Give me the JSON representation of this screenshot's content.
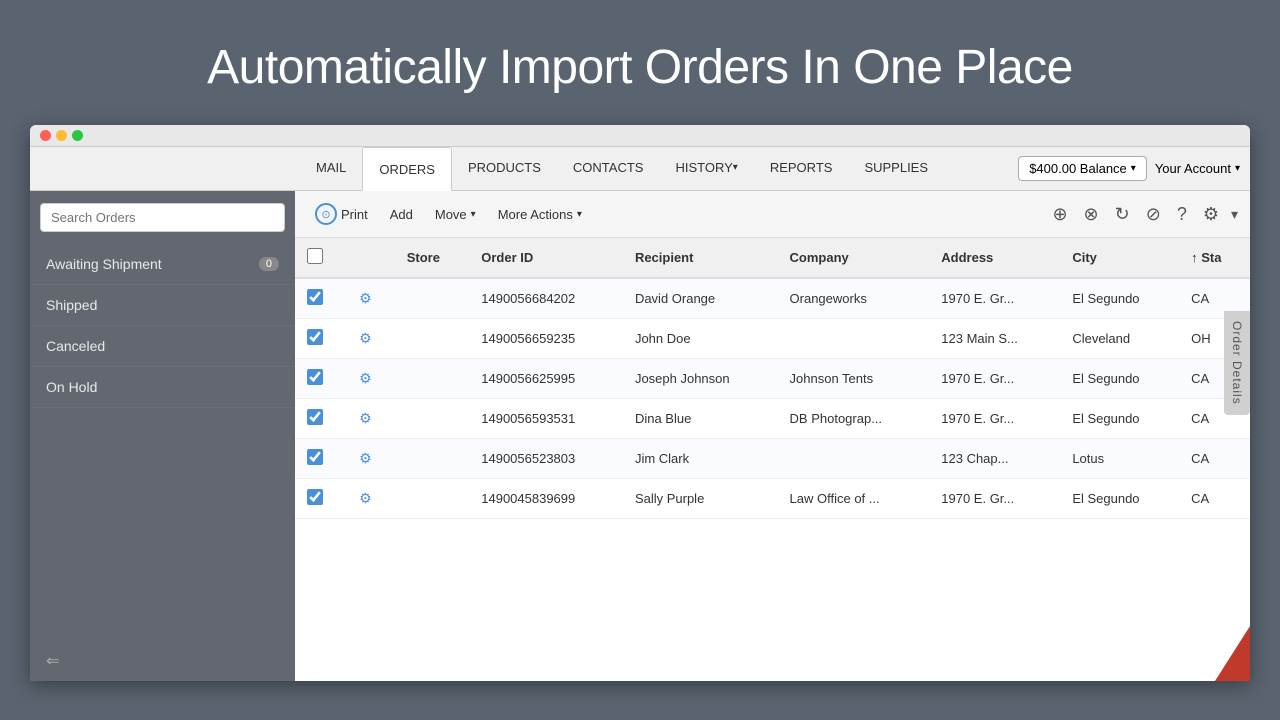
{
  "hero": {
    "title": "Automatically Import Orders In One Place"
  },
  "nav": {
    "items": [
      {
        "label": "MAIL",
        "id": "mail",
        "active": false,
        "hasArrow": false
      },
      {
        "label": "ORDERS",
        "id": "orders",
        "active": true,
        "hasArrow": false
      },
      {
        "label": "PRODUCTS",
        "id": "products",
        "active": false,
        "hasArrow": false
      },
      {
        "label": "CONTACTS",
        "id": "contacts",
        "active": false,
        "hasArrow": false
      },
      {
        "label": "HISTORY",
        "id": "history",
        "active": false,
        "hasArrow": true
      },
      {
        "label": "REPORTS",
        "id": "reports",
        "active": false,
        "hasArrow": false
      },
      {
        "label": "SUPPLIES",
        "id": "supplies",
        "active": false,
        "hasArrow": false
      }
    ],
    "balance": "$400.00 Balance",
    "account": "Your Account"
  },
  "sidebar": {
    "search_placeholder": "Search Orders",
    "items": [
      {
        "label": "Awaiting Shipment",
        "badge": "0",
        "active": false
      },
      {
        "label": "Shipped",
        "badge": null,
        "active": false
      },
      {
        "label": "Canceled",
        "badge": null,
        "active": false
      },
      {
        "label": "On Hold",
        "badge": null,
        "active": false
      }
    ]
  },
  "toolbar": {
    "print_label": "Print",
    "add_label": "Add",
    "move_label": "Move",
    "more_actions_label": "More Actions"
  },
  "table": {
    "columns": [
      {
        "label": "",
        "id": "checkbox"
      },
      {
        "label": "",
        "id": "gear"
      },
      {
        "label": "Store",
        "id": "store"
      },
      {
        "label": "Order ID",
        "id": "order_id"
      },
      {
        "label": "Recipient",
        "id": "recipient"
      },
      {
        "label": "Company",
        "id": "company"
      },
      {
        "label": "Address",
        "id": "address"
      },
      {
        "label": "City",
        "id": "city"
      },
      {
        "label": "↑ Sta",
        "id": "state"
      }
    ],
    "rows": [
      {
        "store": "",
        "order_id": "1490056684202",
        "recipient": "David Orange",
        "company": "Orangeworks",
        "address": "1970 E. Gr...",
        "city": "El Segundo",
        "state": "CA"
      },
      {
        "store": "",
        "order_id": "1490056659235",
        "recipient": "John Doe",
        "company": "",
        "address": "123 Main S...",
        "city": "Cleveland",
        "state": "OH"
      },
      {
        "store": "",
        "order_id": "1490056625995",
        "recipient": "Joseph Johnson",
        "company": "Johnson Tents",
        "address": "1970 E. Gr...",
        "city": "El Segundo",
        "state": "CA"
      },
      {
        "store": "",
        "order_id": "1490056593531",
        "recipient": "Dina Blue",
        "company": "DB Photograp...",
        "address": "1970 E. Gr...",
        "city": "El Segundo",
        "state": "CA"
      },
      {
        "store": "",
        "order_id": "1490056523803",
        "recipient": "Jim Clark",
        "company": "",
        "address": "123 Chap...",
        "city": "Lotus",
        "state": "CA"
      },
      {
        "store": "",
        "order_id": "1490045839699",
        "recipient": "Sally Purple",
        "company": "Law Office of ...",
        "address": "1970 E. Gr...",
        "city": "El Segundo",
        "state": "CA"
      }
    ]
  },
  "order_details_tab": "Order Details"
}
